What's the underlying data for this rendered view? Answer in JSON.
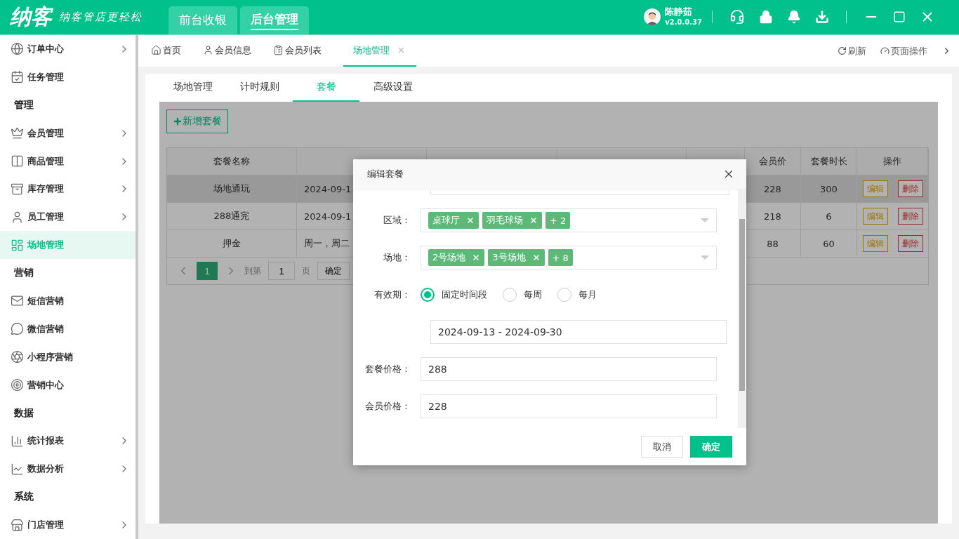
{
  "brand": {
    "logo": "纳客",
    "slogan": "纳客管店更轻松"
  },
  "top_tabs": [
    {
      "label": "前台收银",
      "selected": false
    },
    {
      "label": "后台管理",
      "selected": true
    }
  ],
  "user": {
    "name": "陈静茹",
    "version": "v2.0.0.37"
  },
  "sidebar": {
    "items": [
      {
        "kind": "item",
        "label": "订单中心",
        "expandable": true,
        "selected": false
      },
      {
        "kind": "item",
        "label": "任务管理",
        "expandable": false,
        "selected": false
      },
      {
        "kind": "section",
        "label": "管理"
      },
      {
        "kind": "item",
        "label": "会员管理",
        "expandable": true,
        "selected": false
      },
      {
        "kind": "item",
        "label": "商品管理",
        "expandable": true,
        "selected": false
      },
      {
        "kind": "item",
        "label": "库存管理",
        "expandable": true,
        "selected": false
      },
      {
        "kind": "item",
        "label": "员工管理",
        "expandable": true,
        "selected": false
      },
      {
        "kind": "item",
        "label": "场地管理",
        "expandable": false,
        "selected": true
      },
      {
        "kind": "section",
        "label": "营销"
      },
      {
        "kind": "item",
        "label": "短信营销",
        "expandable": false,
        "selected": false
      },
      {
        "kind": "item",
        "label": "微信营销",
        "expandable": false,
        "selected": false
      },
      {
        "kind": "item",
        "label": "小程序营销",
        "expandable": false,
        "selected": false
      },
      {
        "kind": "item",
        "label": "营销中心",
        "expandable": false,
        "selected": false
      },
      {
        "kind": "section",
        "label": "数据"
      },
      {
        "kind": "item",
        "label": "统计报表",
        "expandable": true,
        "selected": false
      },
      {
        "kind": "item",
        "label": "数据分析",
        "expandable": true,
        "selected": false
      },
      {
        "kind": "section",
        "label": "系统"
      },
      {
        "kind": "item",
        "label": "门店管理",
        "expandable": true,
        "selected": false
      }
    ]
  },
  "page_tabs": [
    {
      "label": "首页",
      "selected": false,
      "closable": false
    },
    {
      "label": "会员信息",
      "selected": false,
      "closable": false
    },
    {
      "label": "会员列表",
      "selected": false,
      "closable": false
    },
    {
      "label": "场地管理",
      "selected": true,
      "closable": true
    }
  ],
  "page_actions": [
    "刷新",
    "页面操作"
  ],
  "sub_tabs": [
    {
      "label": "场地管理",
      "selected": false
    },
    {
      "label": "计时规则",
      "selected": false
    },
    {
      "label": "套餐",
      "selected": true
    },
    {
      "label": "高级设置",
      "selected": false
    }
  ],
  "add_button": "新增套餐",
  "table": {
    "columns": [
      "套餐名称",
      "会员价",
      "套餐时长",
      "操作"
    ],
    "rows": [
      {
        "name": "场地通玩",
        "column_2": "2024-09-1",
        "member_price": "228",
        "duration": "300",
        "highlighted": true,
        "actions": [
          "编辑",
          "删除"
        ]
      },
      {
        "name": "288通完",
        "column_2": "2024-09-1",
        "member_price": "218",
        "duration": "6",
        "highlighted": false,
        "actions": [
          "编辑",
          "删除"
        ]
      },
      {
        "name": "押金",
        "column_2": "周一，周二",
        "member_price": "88",
        "duration": "60",
        "highlighted": false,
        "actions": [
          "编辑",
          "删除"
        ]
      }
    ]
  },
  "pagination": {
    "pages": [
      {
        "label": "1",
        "selected": true
      }
    ],
    "goto_label": "到第",
    "goto_value": "1",
    "page_unit": "页",
    "confirm": "确定"
  },
  "dialog": {
    "title": "编辑套餐",
    "fields": [
      {
        "kind": "tags",
        "label": "区域：",
        "tags": [
          "桌球厅",
          "羽毛球场"
        ],
        "more": "+ 2"
      },
      {
        "kind": "tags",
        "label": "场地：",
        "tags": [
          "2号场地",
          "3号场地"
        ],
        "more": "+ 8"
      },
      {
        "kind": "radio",
        "label": "有效期：",
        "options": [
          {
            "label": "固定时间段",
            "selected": true
          },
          {
            "label": "每周",
            "selected": false
          },
          {
            "label": "每月",
            "selected": false
          }
        ]
      },
      {
        "kind": "text",
        "value": "2024-09-13 - 2024-09-30"
      },
      {
        "kind": "text",
        "label": "套餐价格：",
        "value": "288"
      },
      {
        "kind": "text",
        "label": "会员价格：",
        "value": "228"
      }
    ],
    "buttons": [
      {
        "label": "取消",
        "primary": false
      },
      {
        "label": "确定",
        "primary": true
      }
    ]
  }
}
